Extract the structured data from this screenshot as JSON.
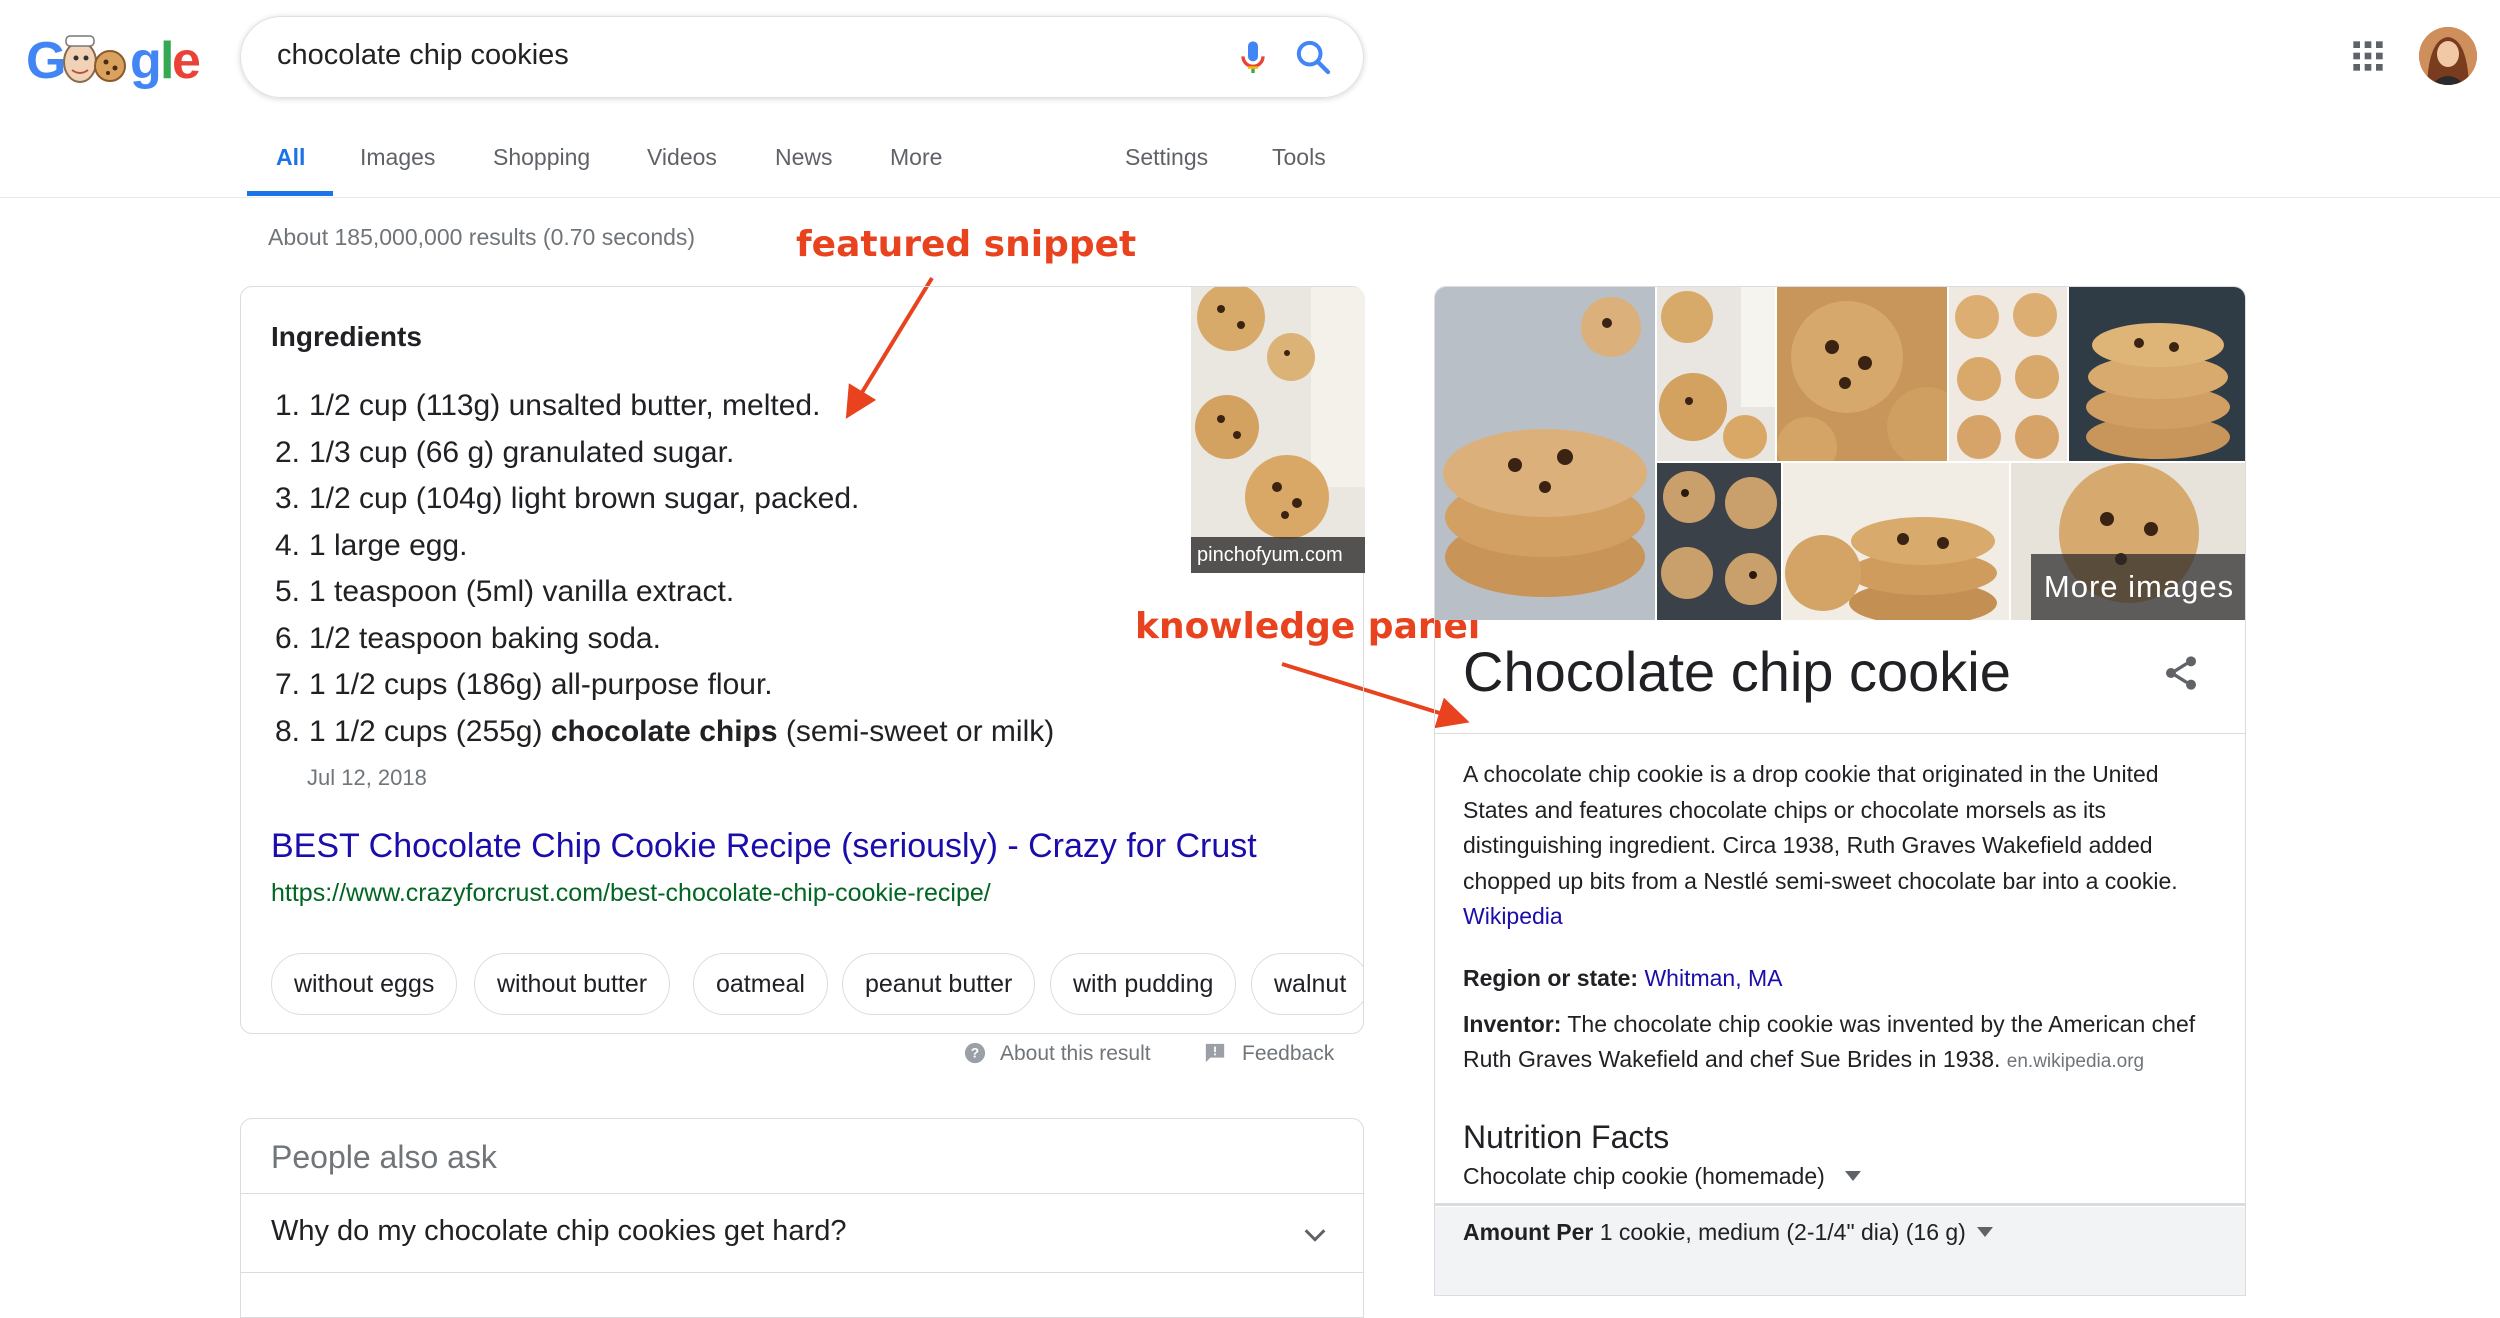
{
  "logo": {
    "letters": [
      "G",
      "o",
      "o",
      "g",
      "l",
      "e"
    ],
    "colors": [
      "#4285F4",
      "#EA4335",
      "#FBBC05",
      "#4285F4",
      "#34A853",
      "#EA4335"
    ]
  },
  "search": {
    "query": "chocolate chip cookies"
  },
  "tabs": {
    "items": [
      {
        "label": "All",
        "active": true
      },
      {
        "label": "Images"
      },
      {
        "label": "Shopping"
      },
      {
        "label": "Videos"
      },
      {
        "label": "News"
      },
      {
        "label": "More"
      }
    ],
    "settings": "Settings",
    "tools": "Tools"
  },
  "result_stats": "About 185,000,000 results (0.70 seconds)",
  "annotations": {
    "featured": "featured snippet",
    "knowledge": "knowledge panel"
  },
  "snippet": {
    "heading": "Ingredients",
    "items": [
      {
        "num": "1.",
        "pre": "1/2 cup (113g) unsalted butter, melted.",
        "bold": "",
        "post": ""
      },
      {
        "num": "2.",
        "pre": "1/3 cup (66 g) granulated sugar.",
        "bold": "",
        "post": ""
      },
      {
        "num": "3.",
        "pre": "1/2 cup (104g) light brown sugar, packed.",
        "bold": "",
        "post": ""
      },
      {
        "num": "4.",
        "pre": "1 large egg.",
        "bold": "",
        "post": ""
      },
      {
        "num": "5.",
        "pre": "1 teaspoon (5ml) vanilla extract.",
        "bold": "",
        "post": ""
      },
      {
        "num": "6.",
        "pre": "1/2 teaspoon baking soda.",
        "bold": "",
        "post": ""
      },
      {
        "num": "7.",
        "pre": "1 1/2 cups (186g) all-purpose flour.",
        "bold": "",
        "post": ""
      },
      {
        "num": "8.",
        "pre": "1 1/2 cups (255g) ",
        "bold": "chocolate chips",
        "post": " (semi-sweet or milk)"
      }
    ],
    "date": "Jul 12, 2018",
    "title": "BEST Chocolate Chip Cookie Recipe (seriously) - Crazy for Crust",
    "url": "https://www.crazyforcrust.com/best-chocolate-chip-cookie-recipe/",
    "image_source": "pinchofyum.com",
    "chips": [
      "without eggs",
      "without butter",
      "oatmeal",
      "peanut butter",
      "with pudding",
      "walnut"
    ]
  },
  "result_footer": {
    "about": "About this result",
    "feedback": "Feedback"
  },
  "people_also_ask": {
    "title": "People also ask",
    "questions": [
      "Why do my chocolate chip cookies get hard?"
    ]
  },
  "knowledge_panel": {
    "more_images": "More images",
    "title": "Chocolate chip cookie",
    "description": "A chocolate chip cookie is a drop cookie that originated in the United States and features chocolate chips or chocolate morsels as its distinguishing ingredient. Circa 1938, Ruth Graves Wakefield added chopped up bits from a Nestlé semi-sweet chocolate bar into a cookie.",
    "description_link": "Wikipedia",
    "region_label": "Region or state:",
    "region_value": "Whitman, MA",
    "inventor_label": "Inventor:",
    "inventor_value": "The chocolate chip cookie was invented by the American chef Ruth Graves Wakefield and chef Sue Brides in 1938.",
    "inventor_source": "en.wikipedia.org",
    "nutrition": {
      "title": "Nutrition Facts",
      "subtitle": "Chocolate chip cookie (homemade)",
      "amount_label": "Amount Per",
      "amount_value": "1 cookie, medium (2-1/4\" dia) (16 g)"
    }
  },
  "colors": {
    "link": "#1a0dab",
    "url": "#006621",
    "accent": "#1a73e8",
    "annotation": "#e8431e"
  }
}
